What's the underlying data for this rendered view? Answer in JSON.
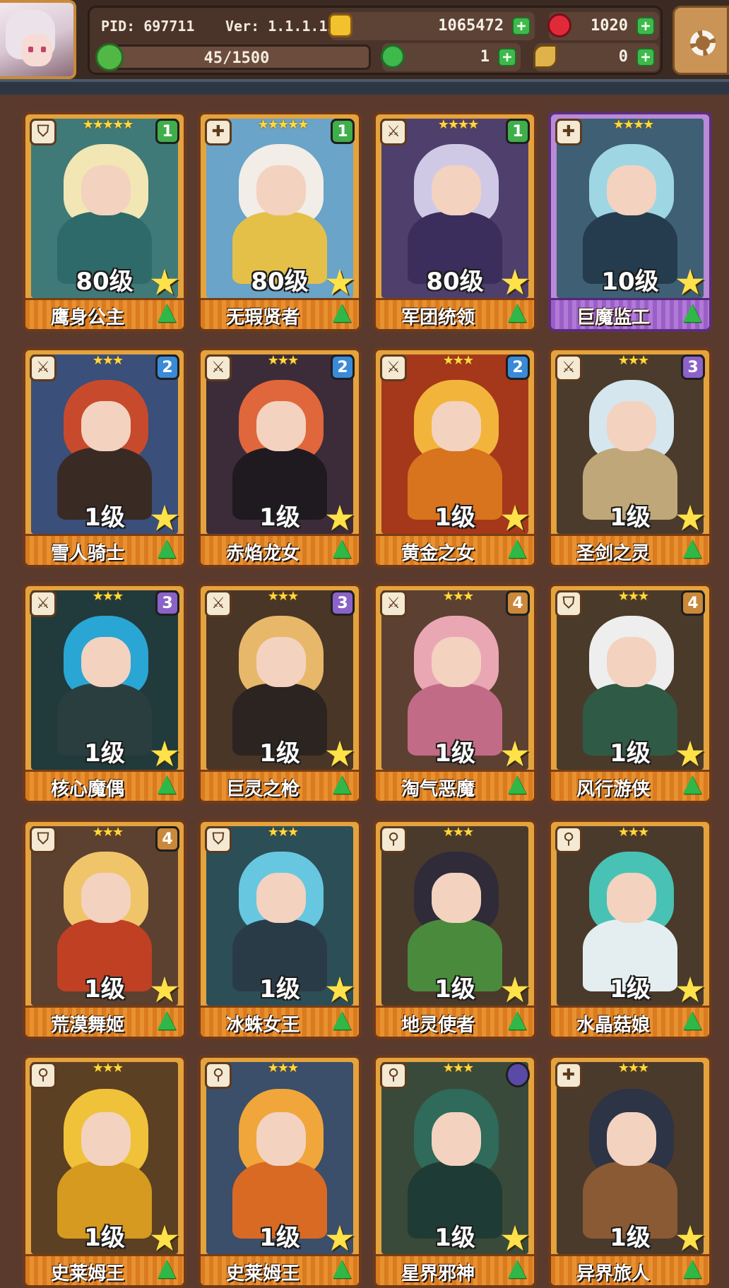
{
  "header": {
    "pid": "PID: 697711",
    "version": "Ver: 1.1.1.13",
    "gold": "1065472",
    "gems": "1020",
    "exp_text": "45/1500",
    "exp_progress": 0.03,
    "clover_count": "1",
    "item_count": "0",
    "plus_symbol": "+",
    "icons": {
      "gold": "gold-coin-icon",
      "gem": "red-gem-icon",
      "exp": "green-clover-icon",
      "clover": "green-clover-icon",
      "item": "horn-icon",
      "settings": "gear-icon"
    }
  },
  "heroes": [
    {
      "name": "鹰身公主",
      "level": "80级",
      "stars": "★★★★★",
      "rank": "1",
      "class_icon": "shield-icon",
      "class_glyph": "⛉",
      "rarity": "orange",
      "palette": [
        "#3f7a78",
        "#f1e6b4",
        "#2e6a69"
      ]
    },
    {
      "name": "无瑕贤者",
      "level": "80级",
      "stars": "★★★★★",
      "rank": "1",
      "class_icon": "cross-icon",
      "class_glyph": "✚",
      "rarity": "orange",
      "palette": [
        "#6aa4c8",
        "#f2ede7",
        "#e4c049"
      ]
    },
    {
      "name": "军团统领",
      "level": "80级",
      "stars": "★★★★",
      "rank": "1",
      "class_icon": "sword-icon",
      "class_glyph": "⚔",
      "rarity": "orange",
      "palette": [
        "#4f3f6c",
        "#cfc9e6",
        "#3b2d5c"
      ]
    },
    {
      "name": "巨魔监工",
      "level": "10级",
      "stars": "★★★★",
      "rank": "",
      "class_icon": "cross-icon",
      "class_glyph": "✚",
      "rarity": "purple",
      "palette": [
        "#3f5f74",
        "#9fd6e3",
        "#253b4e"
      ]
    },
    {
      "name": "雪人骑士",
      "level": "1级",
      "stars": "★★★",
      "rank": "2",
      "class_icon": "sword-icon",
      "class_glyph": "⚔",
      "rarity": "orange",
      "palette": [
        "#3a4f7a",
        "#c84a2c",
        "#3a2a24"
      ]
    },
    {
      "name": "赤焰龙女",
      "level": "1级",
      "stars": "★★★",
      "rank": "2",
      "class_icon": "sword-icon",
      "class_glyph": "⚔",
      "rarity": "orange",
      "palette": [
        "#3c2c3a",
        "#e0673b",
        "#1f1a20"
      ]
    },
    {
      "name": "黄金之女",
      "level": "1级",
      "stars": "★★★",
      "rank": "2",
      "class_icon": "sword-icon",
      "class_glyph": "⚔",
      "rarity": "orange",
      "palette": [
        "#a5381a",
        "#f3b43c",
        "#d8731e"
      ]
    },
    {
      "name": "圣剑之灵",
      "level": "1级",
      "stars": "★★★",
      "rank": "3",
      "class_icon": "sword-icon",
      "class_glyph": "⚔",
      "rarity": "orange",
      "palette": [
        "#4a3b2c",
        "#d5e6ef",
        "#bfa77a"
      ]
    },
    {
      "name": "核心魔偶",
      "level": "1级",
      "stars": "★★★",
      "rank": "3",
      "class_icon": "sword-icon",
      "class_glyph": "⚔",
      "rarity": "orange",
      "palette": [
        "#213a3c",
        "#2aa6d4",
        "#2b3e3f"
      ]
    },
    {
      "name": "巨灵之枪",
      "level": "1级",
      "stars": "★★★",
      "rank": "3",
      "class_icon": "sword-icon",
      "class_glyph": "⚔",
      "rarity": "orange",
      "palette": [
        "#4a3626",
        "#e7b86a",
        "#2c2420"
      ]
    },
    {
      "name": "淘气恶魔",
      "level": "1级",
      "stars": "★★★",
      "rank": "4",
      "class_icon": "sword-icon",
      "class_glyph": "⚔",
      "rarity": "orange",
      "palette": [
        "#5c4032",
        "#e9a7b4",
        "#c26b86"
      ]
    },
    {
      "name": "风行游侠",
      "level": "1级",
      "stars": "★★★",
      "rank": "4",
      "class_icon": "shield-icon",
      "class_glyph": "⛉",
      "rarity": "orange",
      "palette": [
        "#4a3a2a",
        "#eeeeee",
        "#2f5a45"
      ]
    },
    {
      "name": "荒漠舞姬",
      "level": "1级",
      "stars": "★★★",
      "rank": "4",
      "class_icon": "shield-icon",
      "class_glyph": "⛉",
      "rarity": "orange",
      "palette": [
        "#5c4030",
        "#f0c56a",
        "#c04024"
      ]
    },
    {
      "name": "冰蛛女王",
      "level": "1级",
      "stars": "★★★",
      "rank": "",
      "class_icon": "shield-icon",
      "class_glyph": "⛉",
      "rarity": "orange",
      "palette": [
        "#2c4e57",
        "#67c7e0",
        "#2a3b48"
      ]
    },
    {
      "name": "地灵使者",
      "level": "1级",
      "stars": "★★★",
      "rank": "",
      "class_icon": "staff-icon",
      "class_glyph": "⚲",
      "rarity": "orange",
      "palette": [
        "#4a3a2c",
        "#2f2b39",
        "#4a8a3c"
      ]
    },
    {
      "name": "水晶菇娘",
      "level": "1级",
      "stars": "★★★",
      "rank": "",
      "class_icon": "staff-icon",
      "class_glyph": "⚲",
      "rarity": "orange",
      "palette": [
        "#4a3a2c",
        "#48c2b4",
        "#e4eef0"
      ]
    },
    {
      "name": "史莱姆王",
      "level": "1级",
      "stars": "★★★",
      "rank": "",
      "class_icon": "staff-icon",
      "class_glyph": "⚲",
      "rarity": "orange",
      "palette": [
        "#5c4023",
        "#f0c23a",
        "#d59a1f"
      ]
    },
    {
      "name": "史莱姆王",
      "level": "1级",
      "stars": "★★★",
      "rank": "",
      "class_icon": "staff-icon",
      "class_glyph": "⚲",
      "rarity": "orange",
      "palette": [
        "#3b4e6a",
        "#f0a63a",
        "#d86a24"
      ]
    },
    {
      "name": "星界邪神",
      "level": "1级",
      "stars": "★★★",
      "rank": "",
      "class_icon": "staff-icon",
      "class_glyph": "⚲",
      "rarity": "orange",
      "palette": [
        "#3a4a3a",
        "#2f6a5a",
        "#1f3b35"
      ]
    },
    {
      "name": "异界旅人",
      "level": "1级",
      "stars": "★★★",
      "rank": "",
      "class_icon": "cross-icon",
      "class_glyph": "✚",
      "rarity": "orange",
      "palette": [
        "#4a3a2c",
        "#2c3446",
        "#8a5a34"
      ]
    }
  ],
  "badge_colors": {
    "1": "#3fae4b",
    "2": "#3a8ad8",
    "3": "#8b63c8",
    "4": "#c9883a",
    "special": "#5a4aa8"
  },
  "star_button_symbol": "★",
  "upgrade_button_symbol": "▲"
}
